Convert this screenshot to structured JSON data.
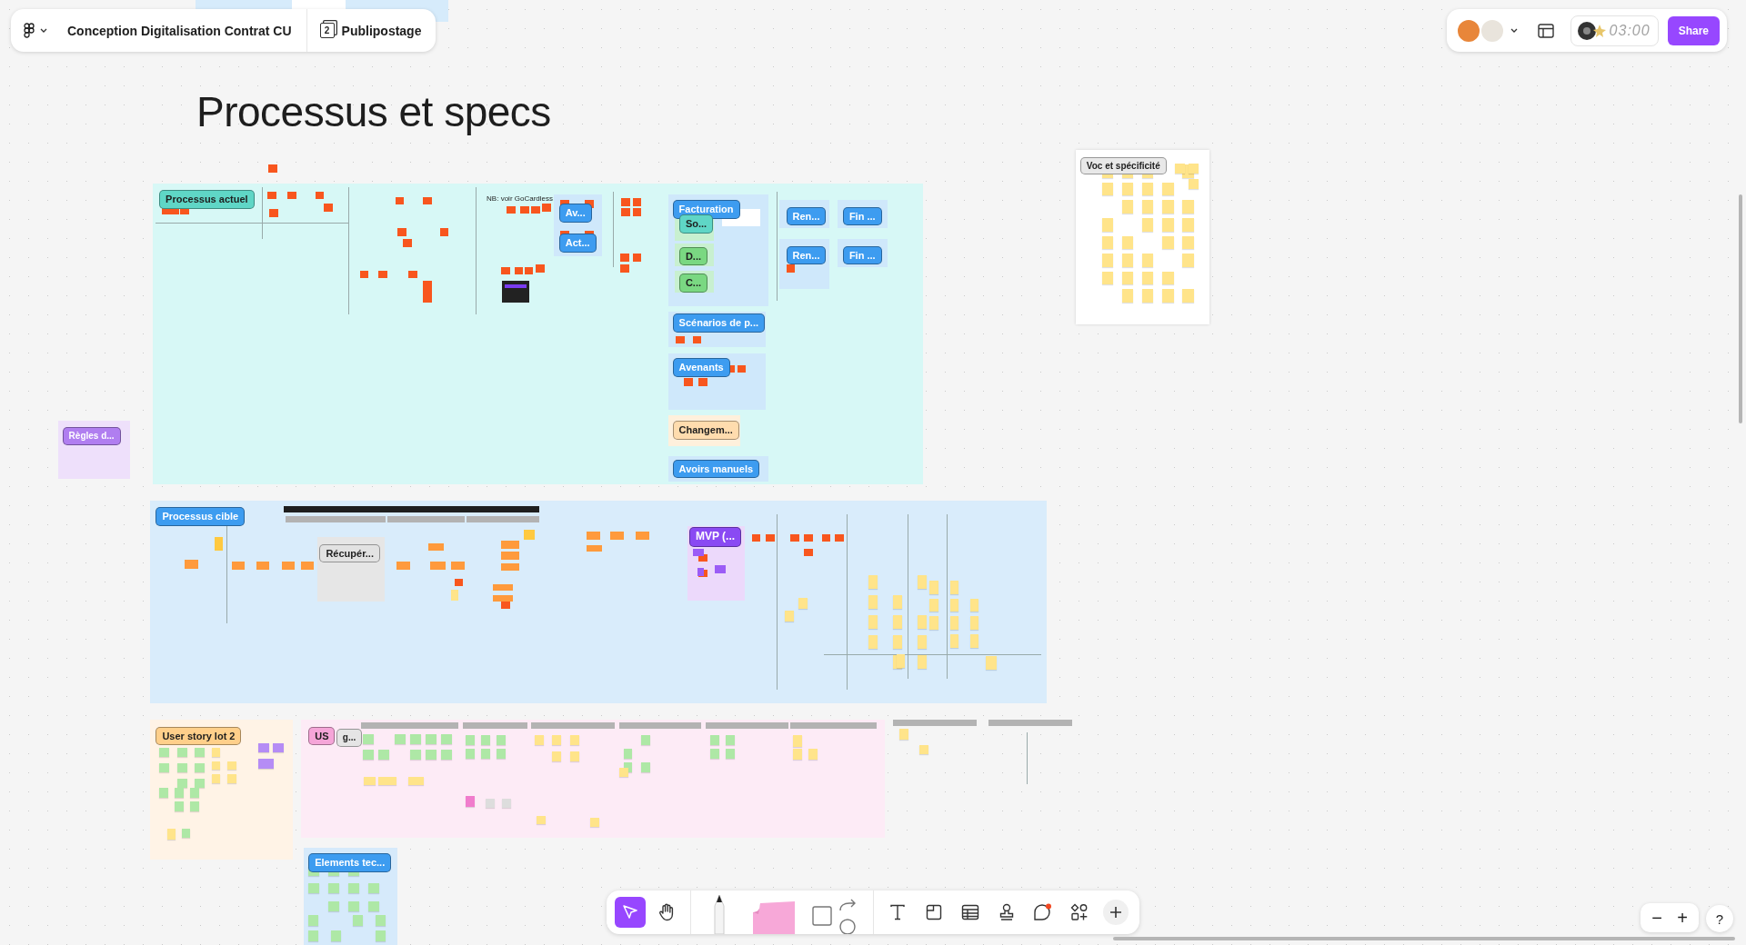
{
  "file": {
    "title": "Conception Digitalisation Contrat CU",
    "page_count": "2",
    "page": "Publipostage"
  },
  "collab": {
    "timer": "03:00",
    "share": "Share"
  },
  "board_title": "Processus et specs",
  "frames": [
    {
      "color": "#d7f8f6"
    },
    {
      "color": "#ffffff"
    },
    {
      "color": "#eee0fb"
    },
    {
      "color": "#d9ecfb"
    },
    {
      "color": "#fff3e6"
    },
    {
      "color": "#fdebf6"
    },
    {
      "color": "#d6eafb"
    }
  ],
  "labels": [
    {
      "text": "Processus actuel",
      "color": "#5fd6c6"
    },
    {
      "text": "Av...",
      "color": "#3d9cf0"
    },
    {
      "text": "Act...",
      "color": "#3d9cf0"
    },
    {
      "text": "Facturation",
      "color": "#3d9cf0"
    },
    {
      "text": "So...",
      "color": "#5fd6c6"
    },
    {
      "text": "D...",
      "color": "#7ad882"
    },
    {
      "text": "C...",
      "color": "#7ad882"
    },
    {
      "text": "Ren...",
      "color": "#3d9cf0"
    },
    {
      "text": "Fin ...",
      "color": "#3d9cf0"
    },
    {
      "text": "Ren...",
      "color": "#3d9cf0"
    },
    {
      "text": "Fin ...",
      "color": "#3d9cf0"
    },
    {
      "text": "Scénarios de p...",
      "color": "#3d9cf0"
    },
    {
      "text": "Avenants",
      "color": "#3d9cf0"
    },
    {
      "text": "Changem...",
      "color": "#ffdcae"
    },
    {
      "text": "Avoirs manuels",
      "color": "#3d9cf0"
    },
    {
      "text": "Voc et spécificité",
      "color": "#e8e8e8"
    },
    {
      "text": "Règles d...",
      "color": "#b07ef0"
    },
    {
      "text": "Processus cible",
      "color": "#3d9cf0"
    },
    {
      "text": "Récupér...",
      "color": "#e2e2e2"
    },
    {
      "text": "MVP (...",
      "color": "#8a4af3"
    },
    {
      "text": "User story lot 2",
      "color": "#ffcf8a"
    },
    {
      "text": "US",
      "color": "#f5a5d8"
    },
    {
      "text": "g...",
      "color": "#e5e5e5"
    },
    {
      "text": "Elements tec...",
      "color": "#3d9cf0"
    }
  ],
  "headings": [
    {
      "text": "NB: voir GoCardless",
      "kind": "note"
    }
  ],
  "tools": [
    {
      "kind": "select",
      "selected": true
    },
    {
      "kind": "hand",
      "selected": false
    },
    {
      "kind": "pen",
      "selected": false
    },
    {
      "kind": "sticky",
      "selected": false
    },
    {
      "kind": "shapes",
      "selected": false
    },
    {
      "kind": "text",
      "selected": false
    },
    {
      "kind": "section",
      "selected": false
    },
    {
      "kind": "table",
      "selected": false
    },
    {
      "kind": "stamp",
      "selected": false
    },
    {
      "kind": "comment",
      "selected": false
    },
    {
      "kind": "widgets",
      "selected": false
    },
    {
      "kind": "more",
      "selected": false
    }
  ],
  "zoom": {
    "out": "−",
    "in": "+"
  },
  "help": "?"
}
